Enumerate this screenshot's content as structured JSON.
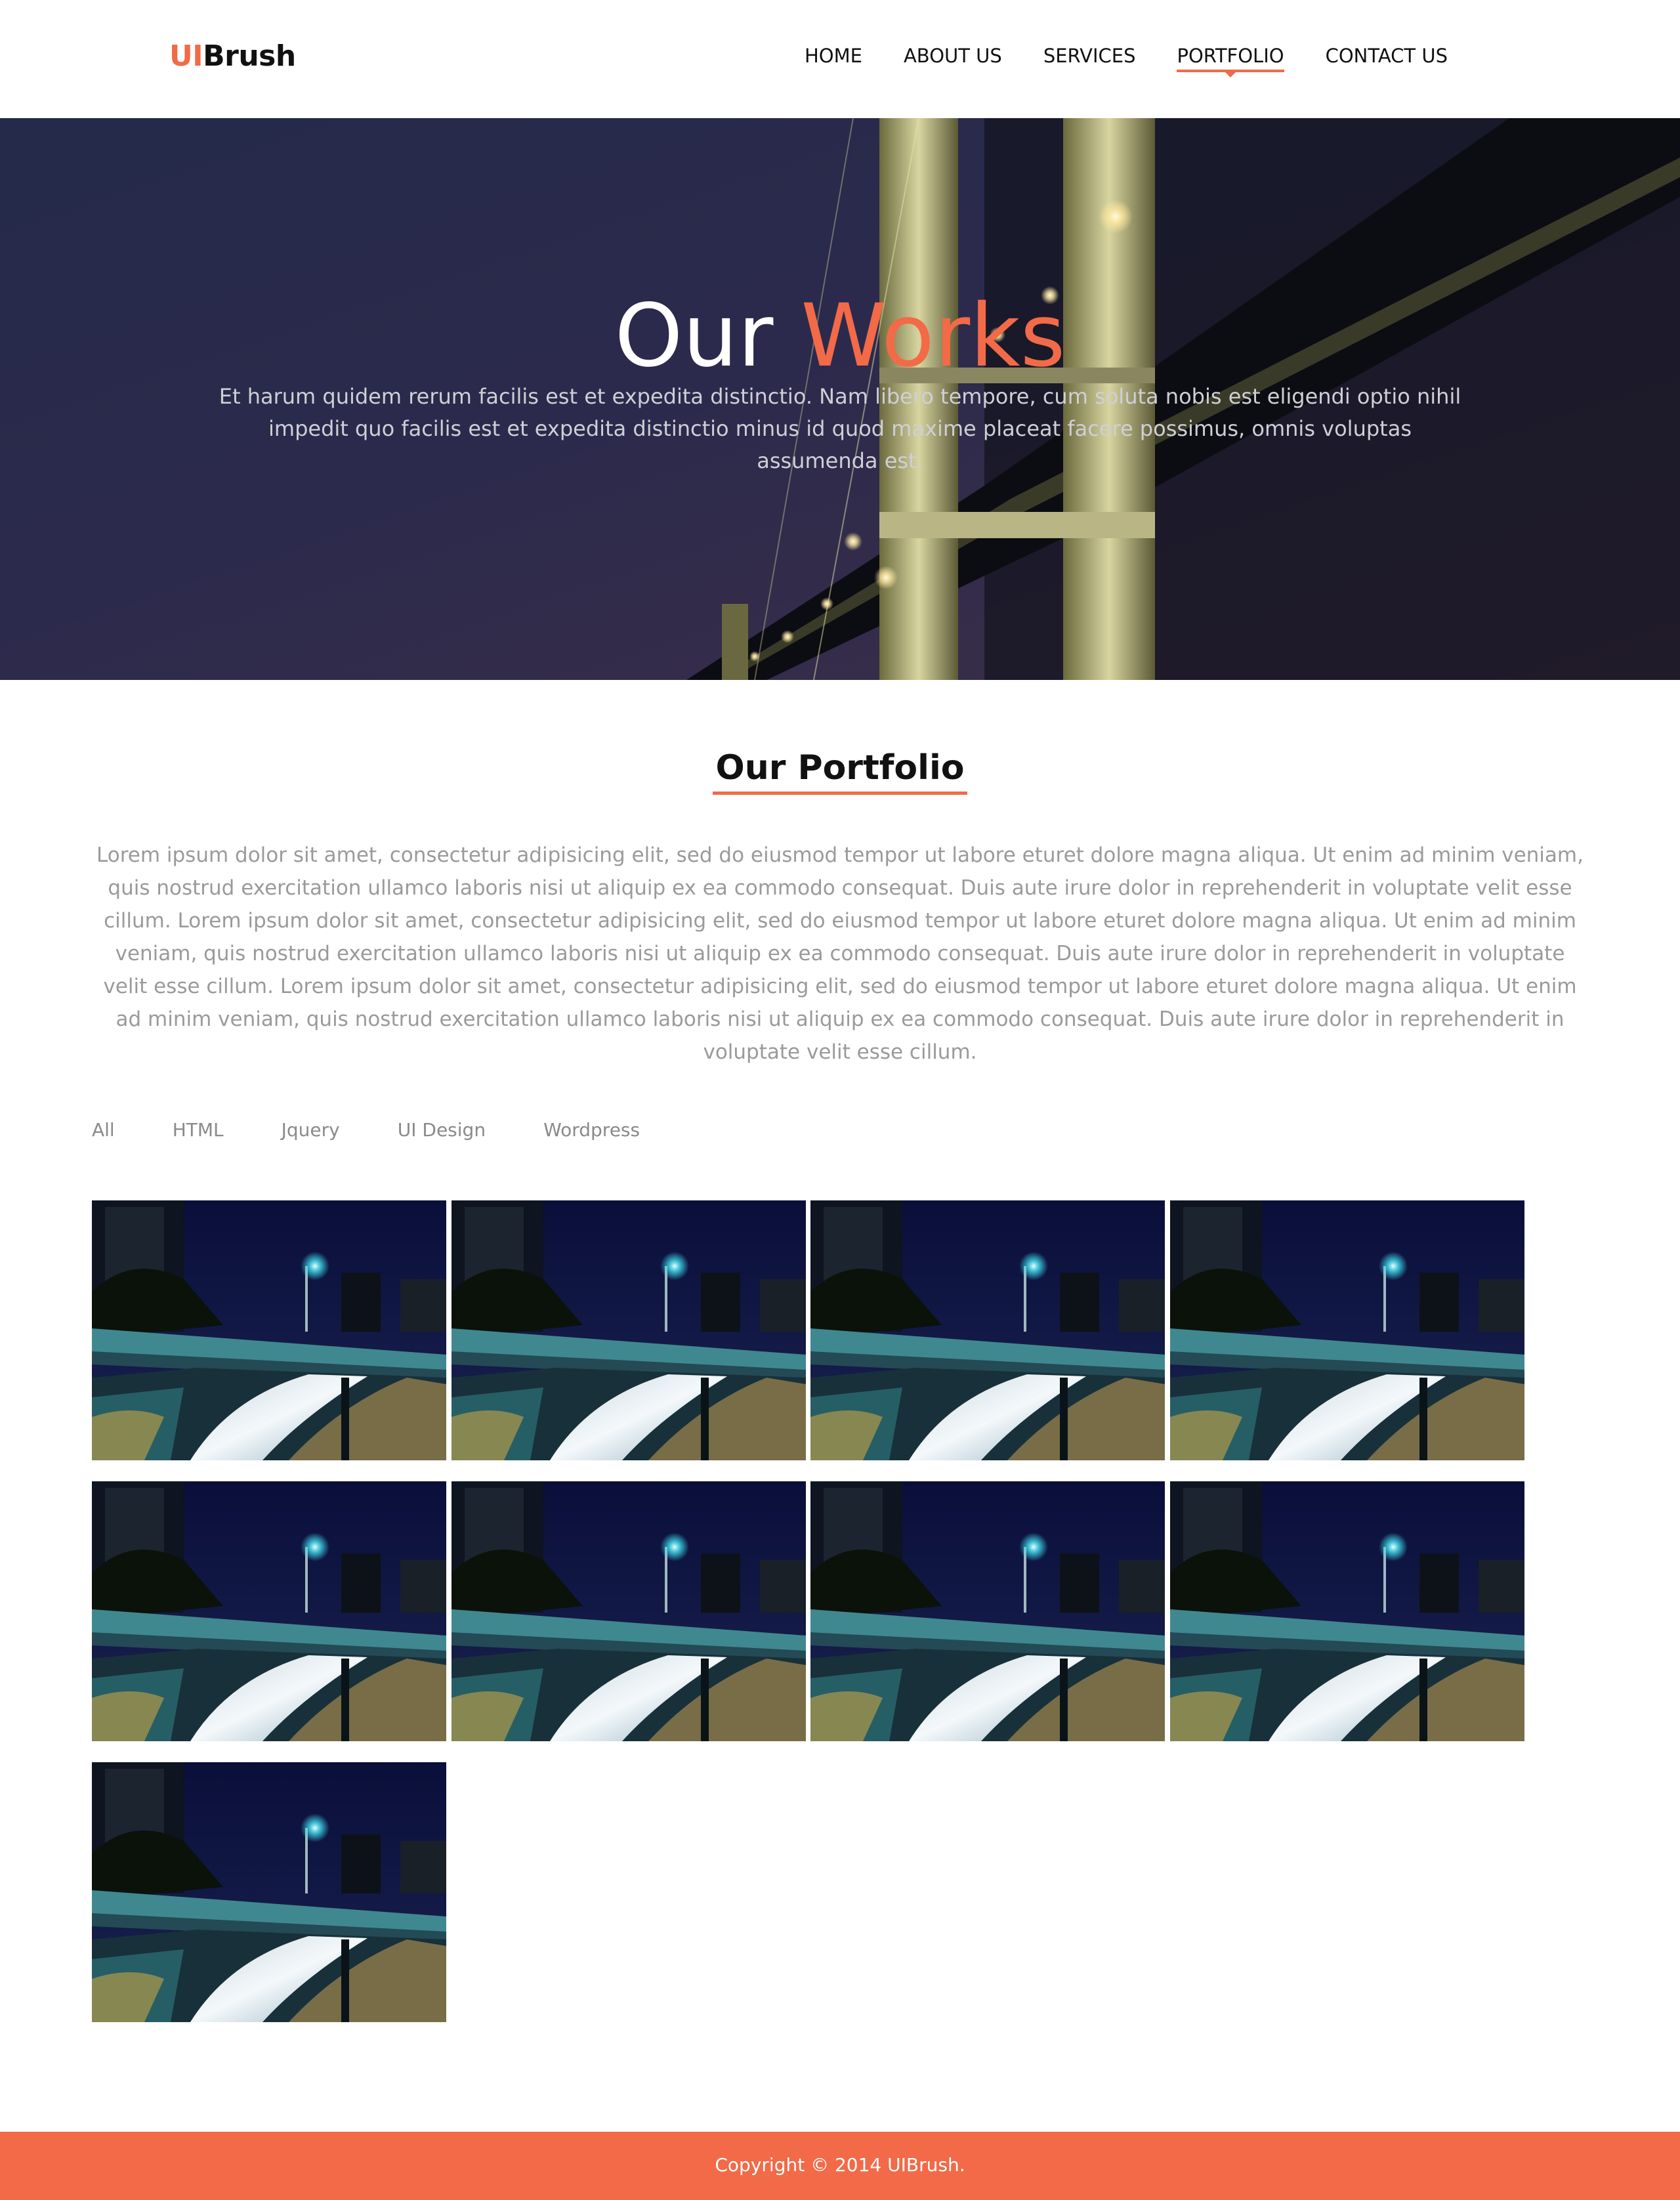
{
  "brand": {
    "accent": "UI",
    "rest": "Brush"
  },
  "nav": [
    {
      "label": "HOME",
      "active": false
    },
    {
      "label": "ABOUT US",
      "active": false
    },
    {
      "label": "SERVICES",
      "active": false
    },
    {
      "label": "PORTFOLIO",
      "active": true
    },
    {
      "label": "CONTACT US",
      "active": false
    }
  ],
  "hero": {
    "title_plain": "Our",
    "title_accent": "Works",
    "subtitle": "Et harum quidem rerum facilis est et expedita distinctio. Nam libero tempore, cum soluta nobis est eligendi optio nihil impedit quo facilis est et expedita distinctio minus id quod maxime placeat facere possimus, omnis voluptas assumenda est.",
    "background_image": "night bridge photo"
  },
  "portfolio": {
    "title": "Our Portfolio",
    "description": "Lorem ipsum dolor sit amet, consectetur adipisicing elit, sed do eiusmod tempor ut labore eturet dolore magna aliqua. Ut enim ad minim veniam, quis nostrud exercitation ullamco laboris nisi ut aliquip ex ea commodo consequat. Duis aute irure dolor in reprehenderit in voluptate velit esse cillum. Lorem ipsum dolor sit amet, consectetur adipisicing elit, sed do eiusmod tempor ut labore eturet dolore magna aliqua. Ut enim ad minim veniam, quis nostrud exercitation ullamco laboris nisi ut aliquip ex ea commodo consequat. Duis aute irure dolor in reprehenderit in voluptate velit esse cillum. Lorem ipsum dolor sit amet, consectetur adipisicing elit, sed do eiusmod tempor ut labore eturet dolore magna aliqua. Ut enim ad minim veniam, quis nostrud exercitation ullamco laboris nisi ut aliquip ex ea commodo consequat. Duis aute irure dolor in reprehenderit in voluptate velit esse cillum.",
    "filters": [
      "All",
      "HTML",
      "Jquery",
      "UI Design",
      "Wordpress"
    ],
    "items_count": 9,
    "item_image": "night highway overpass photo"
  },
  "footer": {
    "copyright": "Copyright © 2014 UIBrush."
  },
  "colors": {
    "accent": "#f26a47",
    "text": "#111111",
    "muted": "#9a9a9a"
  }
}
